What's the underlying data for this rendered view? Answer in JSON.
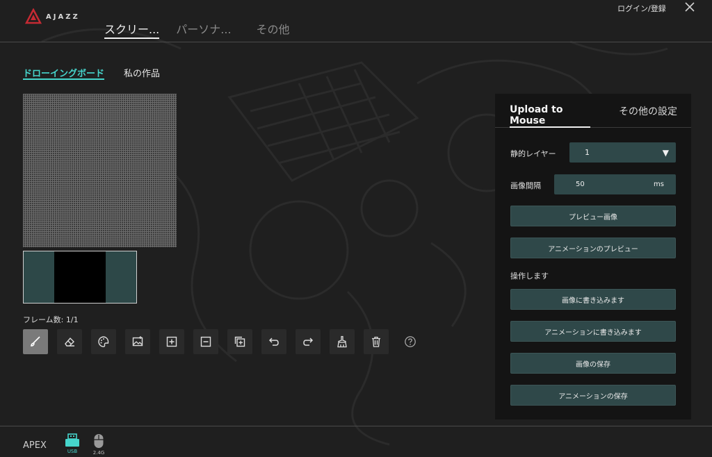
{
  "header": {
    "logo_text": "AJAZZ",
    "login_label": "ログイン/登録",
    "tabs": [
      {
        "label": "スクリー..."
      },
      {
        "label": "パーソナ..."
      },
      {
        "label": "その他"
      }
    ]
  },
  "subtabs": [
    {
      "label": "ドローイングボード"
    },
    {
      "label": "私の作品"
    }
  ],
  "editor": {
    "frame_count": "フレーム数: 1/1"
  },
  "tools": [
    "brush-icon",
    "eraser-icon",
    "palette-icon",
    "image-icon",
    "add-frame-icon",
    "remove-frame-icon",
    "duplicate-frame-icon",
    "undo-icon",
    "redo-icon",
    "clear-icon",
    "trash-icon",
    "help-icon"
  ],
  "panel": {
    "tabs": [
      {
        "label": "Upload to Mouse"
      },
      {
        "label": "その他の設定"
      }
    ],
    "static_layer_label": "静的レイヤー",
    "static_layer_value": "1",
    "interval_label": "画像間隔",
    "interval_value": "50",
    "interval_unit": "ms",
    "preview_image": "プレビュー画像",
    "preview_animation": "アニメーションのプレビュー",
    "operate_label": "操作します",
    "write_image": "画像に書き込みます",
    "write_animation": "アニメーションに書き込みます",
    "save_image": "画像の保存",
    "save_animation": "アニメーションの保存"
  },
  "footer": {
    "device_name": "APEX",
    "usb_label": "USB",
    "wireless_label": "2.4G"
  },
  "colors": {
    "accent": "#46d5cc",
    "button_bg": "#2f4849",
    "panel_bg": "#141414",
    "background": "#1f1f1f"
  }
}
